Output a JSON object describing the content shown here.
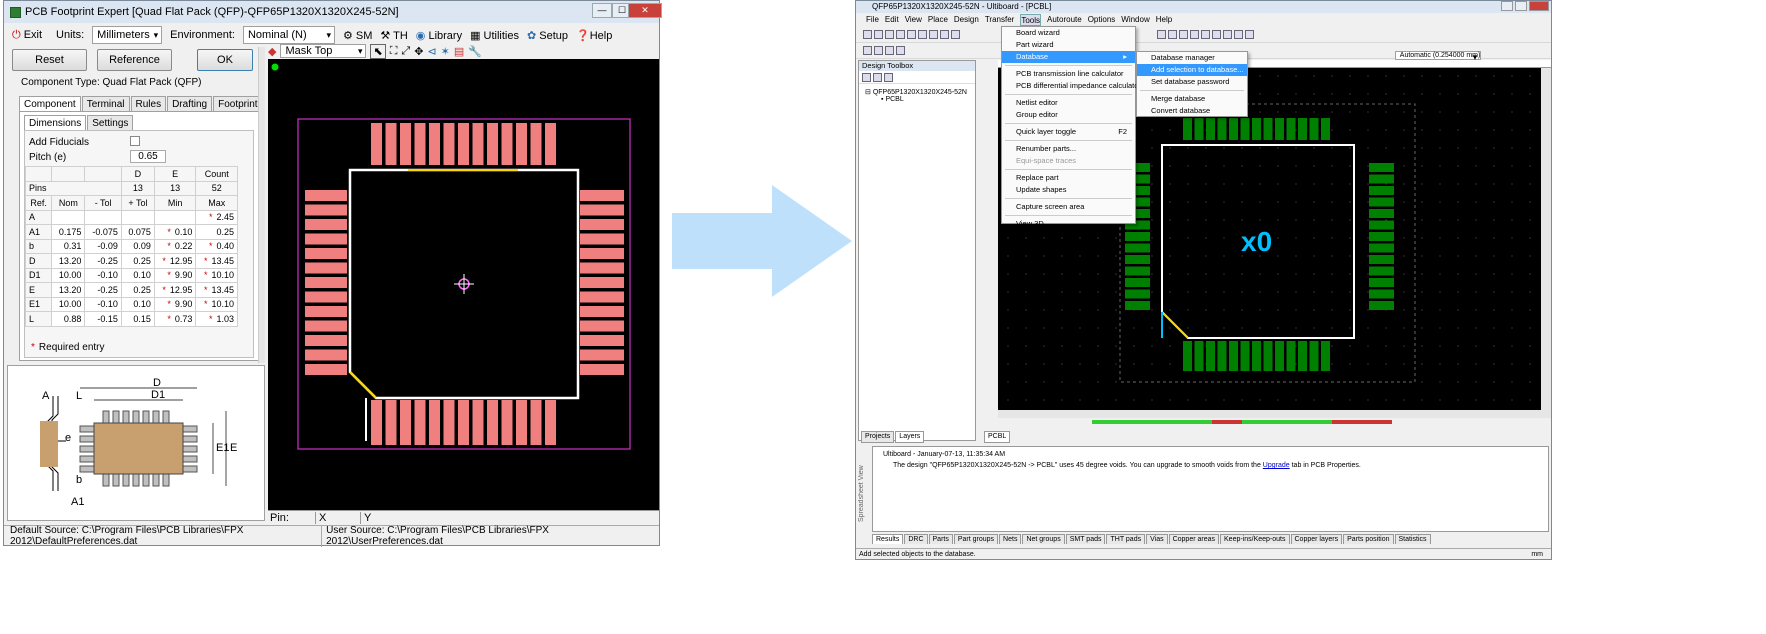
{
  "left_window": {
    "title": "PCB Footprint Expert [Quad Flat Pack (QFP)-QFP65P1320X1320X245-52N]",
    "controls": {
      "min": "—",
      "max": "☐",
      "close": "✕"
    },
    "toolbar1": {
      "exit": "Exit",
      "units_label": "Units:",
      "units_value": "Millimeters",
      "env_label": "Environment:",
      "env_value": "Nominal (N)",
      "sm": "SM",
      "th": "TH",
      "library": "Library",
      "utilities": "Utilities",
      "setup": "Setup",
      "help": "Help"
    },
    "buttons": {
      "reset": "Reset",
      "reference": "Reference",
      "ok": "OK"
    },
    "layer_select": "Mask Top",
    "component_type": "Component Type: Quad Flat Pack (QFP)",
    "tabs": [
      "Component",
      "Terminal",
      "Rules",
      "Drafting",
      "Footprint"
    ],
    "subtabs": [
      "Dimensions",
      "Settings"
    ],
    "add_fiducials": "Add Fiducials",
    "pitch_label": "Pitch (e)",
    "pitch_value": "0.65",
    "de_header": {
      "d": "D",
      "e": "E",
      "count": "Count"
    },
    "pins": {
      "label": "Pins",
      "d": "13",
      "e": "13",
      "count": "52"
    },
    "table_headers": [
      "Ref.",
      "Nom",
      "- Tol",
      "+ Tol",
      "Min",
      "Max"
    ],
    "table_rows": [
      {
        "ref": "A",
        "nom": "",
        "mtol": "",
        "ptol": "",
        "min": "",
        "max": "2.45",
        "min_req": false,
        "max_req": true
      },
      {
        "ref": "A1",
        "nom": "0.175",
        "mtol": "-0.075",
        "ptol": "0.075",
        "min": "0.10",
        "max": "0.25",
        "min_req": true,
        "max_req": false
      },
      {
        "ref": "b",
        "nom": "0.31",
        "mtol": "-0.09",
        "ptol": "0.09",
        "min": "0.22",
        "max": "0.40",
        "min_req": true,
        "max_req": true
      },
      {
        "ref": "D",
        "nom": "13.20",
        "mtol": "-0.25",
        "ptol": "0.25",
        "min": "12.95",
        "max": "13.45",
        "min_req": true,
        "max_req": true
      },
      {
        "ref": "D1",
        "nom": "10.00",
        "mtol": "-0.10",
        "ptol": "0.10",
        "min": "9.90",
        "max": "10.10",
        "min_req": true,
        "max_req": true
      },
      {
        "ref": "E",
        "nom": "13.20",
        "mtol": "-0.25",
        "ptol": "0.25",
        "min": "12.95",
        "max": "13.45",
        "min_req": true,
        "max_req": true
      },
      {
        "ref": "E1",
        "nom": "10.00",
        "mtol": "-0.10",
        "ptol": "0.10",
        "min": "9.90",
        "max": "10.10",
        "min_req": true,
        "max_req": true
      },
      {
        "ref": "L",
        "nom": "0.88",
        "mtol": "-0.15",
        "ptol": "0.15",
        "min": "0.73",
        "max": "1.03",
        "min_req": true,
        "max_req": true
      }
    ],
    "required_entry": "Required entry",
    "drawing_labels": {
      "a": "A",
      "l": "L",
      "e": "e",
      "b": "b",
      "a1": "A1",
      "d": "D",
      "d1": "D1",
      "e1": "E1",
      "e_big": "E"
    },
    "pin_status": {
      "pin": "Pin:",
      "x": "X",
      "y": "Y"
    },
    "status": {
      "default_source": "Default Source:  C:\\Program Files\\PCB Libraries\\FPX 2012\\DefaultPreferences.dat",
      "user_source": "User Source:  C:\\Program Files\\PCB Libraries\\FPX 2012\\UserPreferences.dat"
    },
    "colors": {
      "pad": "#f08080",
      "outline": "#ffffff",
      "boundary": "#cc33cc",
      "pin1": "#ffd700"
    }
  },
  "right_window": {
    "title": "QFP65P1320X1320X245-52N - Ultiboard - [PCBL]",
    "menubar": [
      "File",
      "Edit",
      "View",
      "Place",
      "Design",
      "Transfer",
      "Tools",
      "Autoroute",
      "Options",
      "Window",
      "Help"
    ],
    "tools_menu": [
      {
        "label": "Board wizard",
        "hi": false,
        "dis": false,
        "sep_after": false,
        "shortcut": ""
      },
      {
        "label": "Part wizard",
        "hi": false,
        "dis": false,
        "sep_after": false,
        "shortcut": ""
      },
      {
        "label": "Database",
        "hi": true,
        "dis": false,
        "sep_after": true,
        "shortcut": "▸"
      },
      {
        "label": "PCB transmission line calculator",
        "hi": false,
        "dis": false,
        "sep_after": false,
        "shortcut": ""
      },
      {
        "label": "PCB differential impedance calculator",
        "hi": false,
        "dis": false,
        "sep_after": true,
        "shortcut": ""
      },
      {
        "label": "Netlist editor",
        "hi": false,
        "dis": false,
        "sep_after": false,
        "shortcut": ""
      },
      {
        "label": "Group editor",
        "hi": false,
        "dis": false,
        "sep_after": true,
        "shortcut": ""
      },
      {
        "label": "Quick layer toggle",
        "hi": false,
        "dis": false,
        "sep_after": true,
        "shortcut": "F2"
      },
      {
        "label": "Renumber parts...",
        "hi": false,
        "dis": false,
        "sep_after": false,
        "shortcut": ""
      },
      {
        "label": "Equi-space traces",
        "hi": false,
        "dis": true,
        "sep_after": true,
        "shortcut": ""
      },
      {
        "label": "Replace part",
        "hi": false,
        "dis": false,
        "sep_after": false,
        "shortcut": ""
      },
      {
        "label": "Update shapes",
        "hi": false,
        "dis": false,
        "sep_after": true,
        "shortcut": ""
      },
      {
        "label": "Capture screen area",
        "hi": false,
        "dis": false,
        "sep_after": true,
        "shortcut": ""
      },
      {
        "label": "View 3D",
        "hi": false,
        "dis": false,
        "sep_after": false,
        "shortcut": ""
      }
    ],
    "db_submenu": [
      {
        "label": "Database manager",
        "hi": false,
        "sep_after": false
      },
      {
        "label": "Add selection to database...",
        "hi": true,
        "sep_after": false
      },
      {
        "label": "Set database password",
        "hi": false,
        "sep_after": true
      },
      {
        "label": "Merge database",
        "hi": false,
        "sep_after": false
      },
      {
        "label": "Convert database",
        "hi": false,
        "sep_after": false
      }
    ],
    "toolbox_title": "Design Toolbox",
    "tree": {
      "root": "QFP65P1320X1320X245-52N",
      "child": "PCBL"
    },
    "toolbox_tabs": [
      "Projects",
      "Layers"
    ],
    "doc_tab": "PCBL",
    "zoom_value": "Automatic (0.254000 mm)",
    "ref_mark": "x0",
    "log": {
      "header": "Ultiboard  -  January-07-13, 11:35:34 AM",
      "msg_a": "The design \"QFP65P1320X1320X245-52N -> PCBL\" uses 45 degree voids. You can upgrade to smooth voids from the",
      "link": "Upgrade",
      "msg_b": "tab in PCB Properties."
    },
    "side_label": "Spreadsheet View",
    "bottom_tabs": [
      "Results",
      "DRC",
      "Parts",
      "Part groups",
      "Nets",
      "Net groups",
      "SMT pads",
      "THT pads",
      "Vias",
      "Copper areas",
      "Keep-ins/Keep-outs",
      "Copper layers",
      "Parts position",
      "Statistics"
    ],
    "status": "Add selected objects to the database.",
    "status_unit": "mm",
    "colors": {
      "pad": "#008000",
      "outline": "#ffffff",
      "accent": "#00bfff"
    }
  }
}
